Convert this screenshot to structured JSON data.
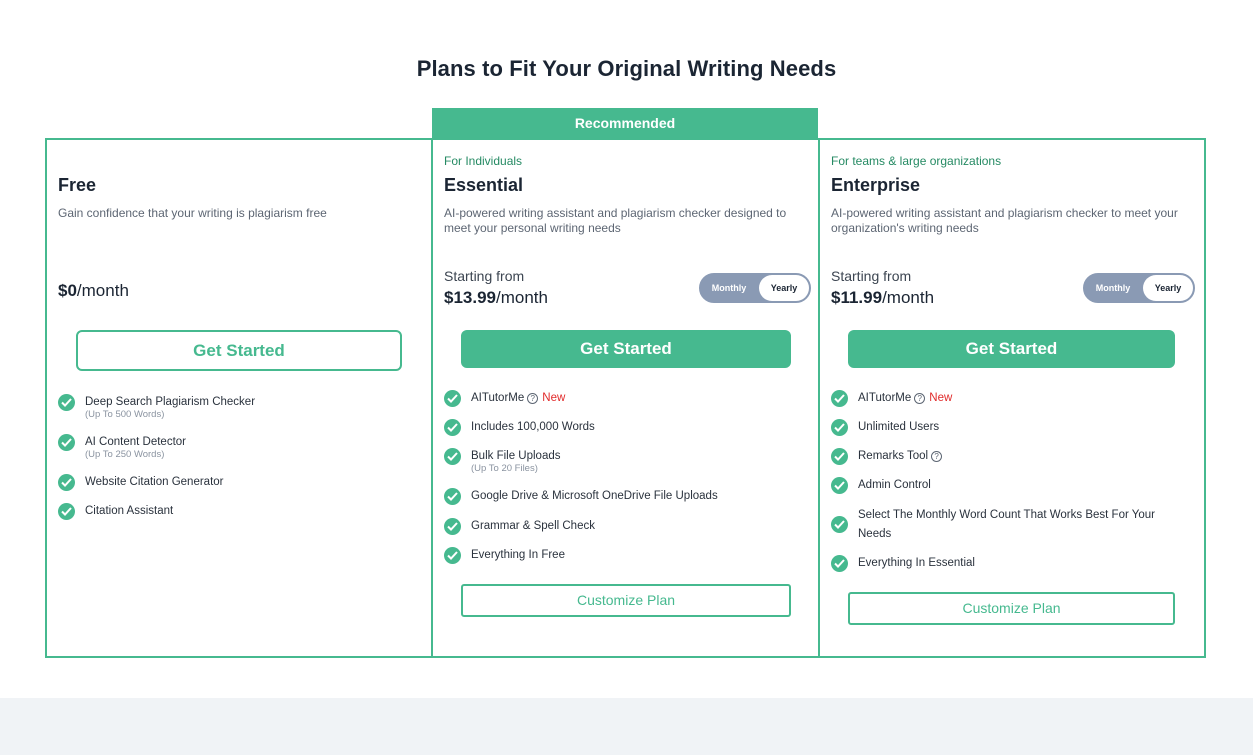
{
  "page": {
    "title": "Plans to Fit Your Original Writing Needs",
    "recommended_label": "Recommended"
  },
  "colors": {
    "accent": "#46b98f",
    "new_badge": "#e12a2a",
    "toggle": "#8a9ab4",
    "footer_band": "#f0f3f6"
  },
  "plans": {
    "free": {
      "name": "Free",
      "description": "Gain confidence that your writing is plagiarism free",
      "price": "$0",
      "per": "/month",
      "cta": "Get Started",
      "features": [
        {
          "label": "Deep Search Plagiarism Checker",
          "sub": "(Up To 500 Words)"
        },
        {
          "label": "AI Content Detector",
          "sub": "(Up To 250 Words)"
        },
        {
          "label": "Website Citation Generator"
        },
        {
          "label": "Citation Assistant"
        }
      ]
    },
    "essential": {
      "audience": "For Individuals",
      "name": "Essential",
      "description": "AI-powered writing assistant and plagiarism checker designed to meet your personal writing needs",
      "starting_from": "Starting from",
      "price": "$13.99",
      "per": "/month",
      "toggle": {
        "monthly": "Monthly",
        "yearly": "Yearly",
        "selected": "Yearly"
      },
      "cta": "Get Started",
      "customize": "Customize Plan",
      "features": [
        {
          "label": "AITutorMe",
          "new": "New"
        },
        {
          "label": "Includes 100,000 Words"
        },
        {
          "label": "Bulk File Uploads",
          "sub": "(Up To 20 Files)"
        },
        {
          "label": "Google Drive & Microsoft OneDrive File Uploads"
        },
        {
          "label": "Grammar & Spell Check"
        },
        {
          "label": "Everything In Free"
        }
      ]
    },
    "enterprise": {
      "audience": "For teams & large organizations",
      "name": "Enterprise",
      "description": "AI-powered writing assistant and plagiarism checker to meet your organization's writing needs",
      "starting_from": "Starting from",
      "price": "$11.99",
      "per": "/month",
      "toggle": {
        "monthly": "Monthly",
        "yearly": "Yearly",
        "selected": "Yearly"
      },
      "cta": "Get Started",
      "customize": "Customize Plan",
      "features": [
        {
          "label": "AITutorMe",
          "new": "New"
        },
        {
          "label": "Unlimited Users"
        },
        {
          "label": "Remarks Tool"
        },
        {
          "label": "Admin Control"
        },
        {
          "label": "Select The Monthly Word Count That Works Best For Your Needs"
        },
        {
          "label": "Everything In Essential"
        }
      ]
    }
  }
}
